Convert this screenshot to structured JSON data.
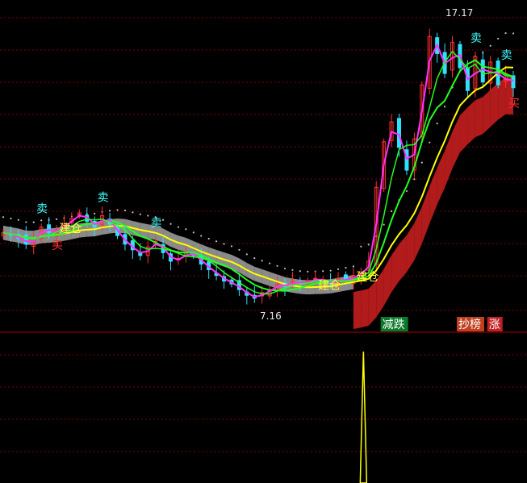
{
  "chart_data": {
    "type": "line",
    "title": "",
    "xlabel": "",
    "ylabel": "",
    "grid": true,
    "colors": {
      "background": "#000000",
      "grid": "#7a0000",
      "separator": "#b00000",
      "up_candle": "#ff3030",
      "down_candle": "#30e0ff",
      "ma_fast": "#ff30ff",
      "ma_mid": "#20ff20",
      "ma_slow": "#ffff00",
      "ribbon_early": "#b8b8b8",
      "ribbon_late": "#d02020",
      "dots": "#c0c0c0",
      "sell_label": "#40ffff",
      "buy_label": "#ff3030",
      "build_label": "#ffff40",
      "volume_spike": "#ffff00"
    },
    "price_marks": [
      {
        "text": "17.17",
        "kind": "high"
      },
      {
        "text": "7.16",
        "kind": "low"
      }
    ],
    "signals": [
      {
        "text": "卖",
        "kind": "sell",
        "bar": 5
      },
      {
        "text": "卖",
        "kind": "sell",
        "bar": 13
      },
      {
        "text": "卖",
        "kind": "sell",
        "bar": 20
      },
      {
        "text": "卖",
        "kind": "sell",
        "bar": 62
      },
      {
        "text": "卖",
        "kind": "sell",
        "bar": 66
      },
      {
        "text": "买",
        "kind": "buy",
        "bar": 7
      },
      {
        "text": "买",
        "kind": "buy",
        "bar": 67
      },
      {
        "text": "建仓",
        "kind": "build",
        "bar": 8
      },
      {
        "text": "建仓",
        "kind": "build",
        "bar": 42
      },
      {
        "text": "建仓",
        "kind": "build",
        "bar": 47
      }
    ],
    "tags": [
      {
        "text": "减跌",
        "bg": "#0a7a2a",
        "bar": 50
      },
      {
        "text": "抄榜",
        "bg": "#c04020",
        "bar": 60
      },
      {
        "text": "涨",
        "bg": "#c02020",
        "bar": 64
      }
    ],
    "closes": [
      9.6,
      9.5,
      9.4,
      9.2,
      9.4,
      9.8,
      9.6,
      9.7,
      9.9,
      10.1,
      10.3,
      10.0,
      9.8,
      10.2,
      9.9,
      9.5,
      9.2,
      9.0,
      8.8,
      9.1,
      9.3,
      8.9,
      8.6,
      8.7,
      8.9,
      8.8,
      8.5,
      8.3,
      8.1,
      7.9,
      7.8,
      7.6,
      7.4,
      7.3,
      7.5,
      7.6,
      7.8,
      7.7,
      7.9,
      7.8,
      7.9,
      8.0,
      7.9,
      7.8,
      8.0,
      7.9,
      8.1,
      8.2,
      8.6,
      11.2,
      12.8,
      13.5,
      12.6,
      11.8,
      12.9,
      14.8,
      16.5,
      15.9,
      15.2,
      16.3,
      15.4,
      14.6,
      15.8,
      14.9,
      15.6,
      14.8,
      15.2,
      14.7
    ],
    "ylim": [
      6.5,
      17.5
    ],
    "spike_bar": 47
  }
}
